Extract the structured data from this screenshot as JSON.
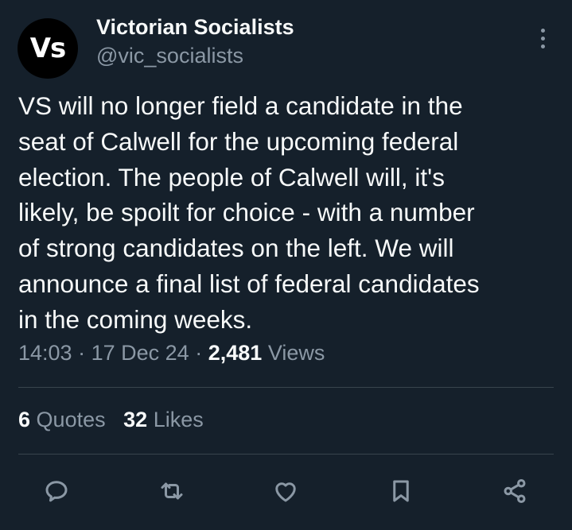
{
  "colors": {
    "background": "#15202b",
    "primary_text": "#f7f9f9",
    "secondary_text": "#8b98a5",
    "divider": "#38444d"
  },
  "author": {
    "avatar_text": "Vs",
    "display_name": "Victorian Socialists",
    "handle": "@vic_socialists"
  },
  "tweet": {
    "lines": [
      "VS will no longer field a candidate in the",
      "seat of Calwell for the upcoming federal",
      "election. The people of Calwell will, it's",
      "likely, be spoilt for choice - with a number",
      "of strong candidates on the left. We will",
      "announce a final list of federal candidates",
      "in the coming weeks."
    ],
    "time": "14:03",
    "separator": "·",
    "date": "17 Dec 24",
    "views_count": "2,481",
    "views_label": "Views"
  },
  "stats": {
    "quotes_count": "6",
    "quotes_label": "Quotes",
    "likes_count": "32",
    "likes_label": "Likes"
  },
  "actions": {
    "icons": [
      "reply-icon",
      "retweet-icon",
      "like-icon",
      "bookmark-icon",
      "share-icon"
    ]
  }
}
